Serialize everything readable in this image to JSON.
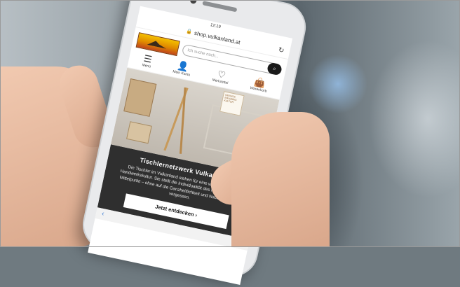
{
  "statusbar": {
    "time": "12:19"
  },
  "browser": {
    "url": "shop.vulkanland.at",
    "reload_icon": "reload-icon",
    "lock_icon": "lock-icon"
  },
  "header": {
    "search_placeholder": "Ich suche nach...",
    "search_icon": "search-icon"
  },
  "nav_icons": [
    {
      "label": "Menü",
      "icon": "menu-icon"
    },
    {
      "label": "Mein Konto",
      "icon": "user-icon"
    },
    {
      "label": "Merkzettel",
      "icon": "heart-icon"
    },
    {
      "label": "Warenkorb",
      "icon": "bag-icon"
    }
  ],
  "hero": {
    "badge_text": "GENUSS ERLEBNIS KULTUR"
  },
  "promo": {
    "title": "Tischlernetzwerk Vulkanland",
    "text": "Die Tischler im Vulkanland stehen für eine wertschätzende Handwerkskultur. Sie stellt die Individualität des Menschen in den Mittelpunkt – ohne auf die Ganzheitlichkeit und Nachhaltigkeit zu vergessen.",
    "button_label": "Jetzt entdecken ›"
  },
  "bottombar": {
    "back": "‹"
  },
  "colors": {
    "promo_bg": "#2f2f2f",
    "accent": "#3a7bd5",
    "logo_orange": "#e08a00"
  }
}
